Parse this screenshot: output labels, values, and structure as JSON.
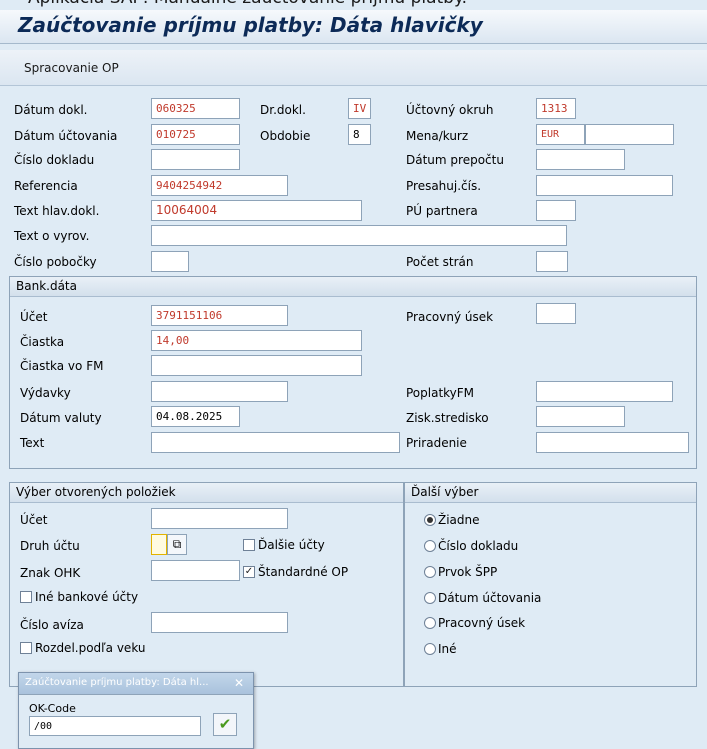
{
  "window_caption": "Aplikácia SAP: Manuálne zaúčtovanie príjmu platby.",
  "title": "Zaúčtovanie príjmu platby: Dáta hlavičky",
  "toolbar": {
    "button_label": "Spracovanie OP"
  },
  "header": {
    "datum_dokl": {
      "label": "Dátum dokl.",
      "value": "060325"
    },
    "datum_uctovania": {
      "label": "Dátum účtovania",
      "value": "010725"
    },
    "cislo_dokladu": {
      "label": "Číslo dokladu",
      "value": ""
    },
    "referencia": {
      "label": "Referencia",
      "value": "9404254942"
    },
    "text_hlav_dokl": {
      "label": "Text hlav.dokl.",
      "value": "10064004"
    },
    "text_o_vyrov": {
      "label": "Text o vyrov.",
      "value": ""
    },
    "cislo_pobocky": {
      "label": "Číslo pobočky",
      "value": ""
    },
    "dr_dokl": {
      "label": "Dr.dokl.",
      "value": "IV"
    },
    "obdobie": {
      "label": "Obdobie",
      "value": "8"
    },
    "uctovny_okruh": {
      "label": "Účtovný okruh",
      "value": "1313"
    },
    "mena_kurz": {
      "label": "Mena/kurz",
      "value": "EUR",
      "rate": ""
    },
    "datum_prepoctu": {
      "label": "Dátum prepočtu",
      "value": ""
    },
    "presahuj_cis": {
      "label": "Presahuj.čís.",
      "value": ""
    },
    "pu_partnera": {
      "label": "PÚ partnera",
      "value": ""
    },
    "pocet_stran": {
      "label": "Počet strán",
      "value": ""
    }
  },
  "bank": {
    "title": "Bank.dáta",
    "ucet": {
      "label": "Účet",
      "value": "3791151106"
    },
    "ciastka": {
      "label": "Čiastka",
      "value": "14,00"
    },
    "ciastka_fm": {
      "label": "Čiastka vo FM",
      "value": ""
    },
    "vydavky": {
      "label": "Výdavky",
      "value": ""
    },
    "datum_valuty": {
      "label": "Dátum valuty",
      "value": "04.08.2025"
    },
    "text": {
      "label": "Text",
      "value": ""
    },
    "pracovny_usek": {
      "label": "Pracovný úsek",
      "value": ""
    },
    "poplatky_fm": {
      "label": "PoplatkyFM",
      "value": ""
    },
    "zisk_stredisko": {
      "label": "Zisk.stredisko",
      "value": ""
    },
    "priradenie": {
      "label": "Priradenie",
      "value": ""
    }
  },
  "open_items": {
    "title": "Výber otvorených položiek",
    "ucet": {
      "label": "Účet",
      "value": ""
    },
    "druh_uctu": {
      "label": "Druh účtu",
      "value": ""
    },
    "dalsie_ucty": {
      "label": "Ďalšie účty",
      "checked": false
    },
    "znak_ohk": {
      "label": "Znak OHK",
      "value": ""
    },
    "standardne_op": {
      "label": "Štandardné OP",
      "checked": true
    },
    "ine_bankove_ucty": {
      "label": "Iné bankové účty",
      "checked": false
    },
    "cislo_aviza": {
      "label": "Číslo avíza",
      "value": ""
    },
    "rozdel_podla_veku": {
      "label": "Rozdel.podľa veku",
      "checked": false
    }
  },
  "dalsi_vyber": {
    "title": "Ďalší výber",
    "options": [
      "Žiadne",
      "Číslo dokladu",
      "Prvok ŠPP",
      "Dátum účtovania",
      "Pracovný úsek",
      "Iné"
    ],
    "selected": "Žiadne"
  },
  "popup": {
    "title": "Zaúčtovanie príjmu platby: Dáta hl...",
    "field_label": "OK-Code",
    "field_value": "/00",
    "colors": {
      "check": "#4a9a1e"
    }
  }
}
